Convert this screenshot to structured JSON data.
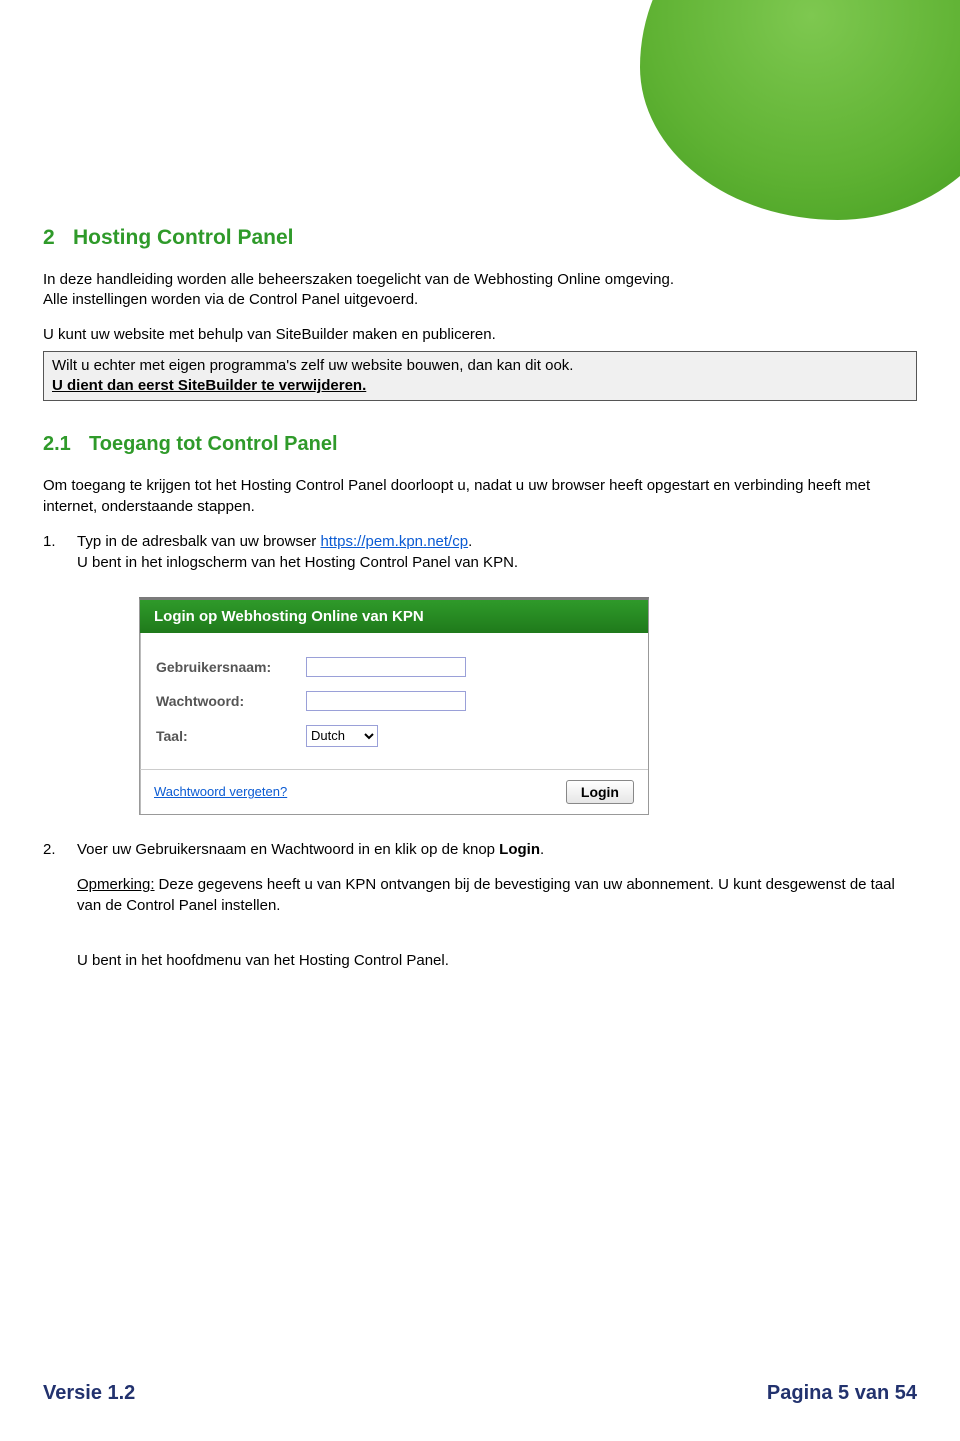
{
  "section": {
    "num": "2",
    "title": "Hosting Control Panel",
    "intro1": "In deze handleiding worden alle beheerszaken toegelicht van de Webhosting Online omgeving.",
    "intro2": "Alle instellingen worden via de Control Panel uitgevoerd.",
    "sitebuilder": "U kunt uw website met behulp van SiteBuilder maken en publiceren.",
    "callout1": "Wilt u echter met eigen programma's zelf uw website bouwen, dan kan dit ook.",
    "callout2": "U dient dan eerst SiteBuilder te verwijderen."
  },
  "subsection": {
    "num": "2.1",
    "title": "Toegang tot Control Panel",
    "intro": "Om toegang te krijgen tot het Hosting Control Panel doorloopt u, nadat u uw browser heeft opgestart en verbinding heeft met internet, onderstaande stappen.",
    "step1_num": "1.",
    "step1_a": "Typ in de adresbalk van uw browser ",
    "step1_link": "https://pem.kpn.net/cp",
    "step1_b": ".",
    "step1_c": "U bent in het inlogscherm van het Hosting Control Panel van KPN.",
    "step2_num": "2.",
    "step2_a": "Voer uw Gebruikersnaam en Wachtwoord in en klik op de knop ",
    "step2_b": "Login",
    "step2_c": ".",
    "note_label": "Opmerking:",
    "note_text": "Deze gegevens heeft u van KPN ontvangen bij de bevestiging van uw abonnement. U kunt desgewenst de taal van de Control Panel instellen.",
    "result": "U bent in het hoofdmenu van het Hosting Control Panel."
  },
  "login_panel": {
    "title": "Login op Webhosting Online van KPN",
    "user_label": "Gebruikersnaam:",
    "pass_label": "Wachtwoord:",
    "lang_label": "Taal:",
    "lang_value": "Dutch",
    "forgot": "Wachtwoord vergeten?",
    "button": "Login"
  },
  "footer": {
    "version": "Versie 1.2",
    "page": "Pagina 5 van 54"
  }
}
